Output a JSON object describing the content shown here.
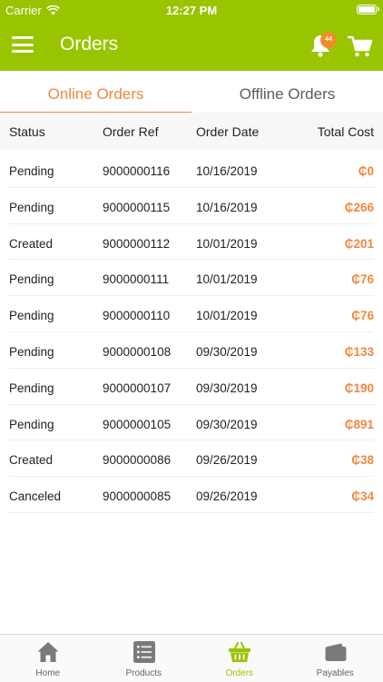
{
  "status_bar": {
    "carrier": "Carrier",
    "time": "12:27 PM"
  },
  "header": {
    "title": "Orders",
    "notification_count": "44",
    "accent_color": "#99c400"
  },
  "tabs": [
    {
      "label": "Online Orders",
      "active": true
    },
    {
      "label": "Offline Orders",
      "active": false
    }
  ],
  "table": {
    "columns": [
      "Status",
      "Order Ref",
      "Order Date",
      "Total Cost"
    ],
    "rows": [
      {
        "status": "Pending",
        "ref": "9000000116",
        "date": "10/16/2019",
        "total": "₵0"
      },
      {
        "status": "Pending",
        "ref": "9000000115",
        "date": "10/16/2019",
        "total": "₵266"
      },
      {
        "status": "Created",
        "ref": "9000000112",
        "date": "10/01/2019",
        "total": "₵201"
      },
      {
        "status": "Pending",
        "ref": "9000000111",
        "date": "10/01/2019",
        "total": "₵76"
      },
      {
        "status": "Pending",
        "ref": "9000000110",
        "date": "10/01/2019",
        "total": "₵76"
      },
      {
        "status": "Pending",
        "ref": "9000000108",
        "date": "09/30/2019",
        "total": "₵133"
      },
      {
        "status": "Pending",
        "ref": "9000000107",
        "date": "09/30/2019",
        "total": "₵190"
      },
      {
        "status": "Pending",
        "ref": "9000000105",
        "date": "09/30/2019",
        "total": "₵891"
      },
      {
        "status": "Created",
        "ref": "9000000086",
        "date": "09/26/2019",
        "total": "₵38"
      },
      {
        "status": "Canceled",
        "ref": "9000000085",
        "date": "09/26/2019",
        "total": "₵34"
      }
    ]
  },
  "tabbar": [
    {
      "label": "Home",
      "icon": "home-icon",
      "active": false
    },
    {
      "label": "Products",
      "icon": "list-icon",
      "active": false
    },
    {
      "label": "Orders",
      "icon": "basket-icon",
      "active": true
    },
    {
      "label": "Payables",
      "icon": "wallet-icon",
      "active": false
    }
  ]
}
